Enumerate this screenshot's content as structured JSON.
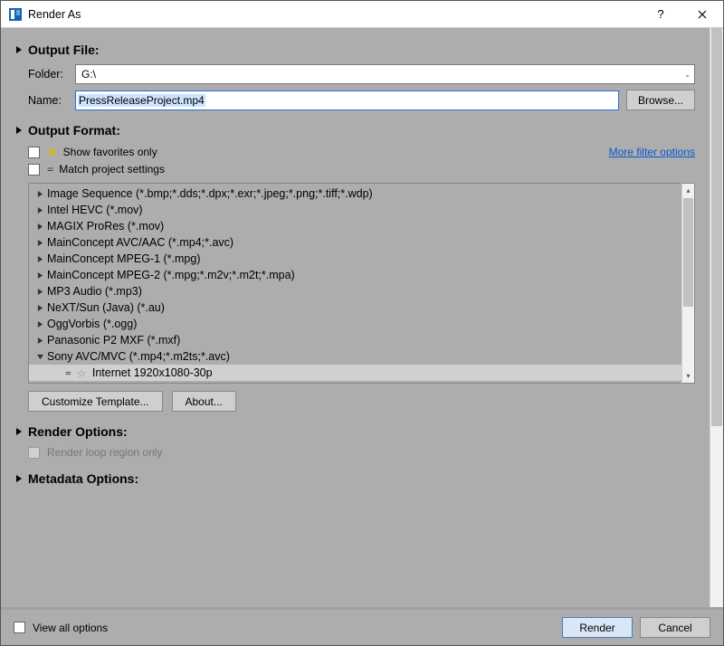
{
  "window": {
    "title": "Render As"
  },
  "sections": {
    "output_file": "Output File:",
    "output_format": "Output Format:",
    "render_options": "Render Options:",
    "metadata_options": "Metadata Options:"
  },
  "output_file": {
    "folder_label": "Folder:",
    "folder_value": "G:\\",
    "name_label": "Name:",
    "name_value": "PressReleaseProject.mp4",
    "browse": "Browse..."
  },
  "output_format": {
    "show_favorites": "Show favorites only",
    "match_project": "Match project settings",
    "more_filter": "More filter options",
    "customize": "Customize Template...",
    "about": "About...",
    "tree": [
      {
        "label": "Image Sequence (*.bmp;*.dds;*.dpx;*.exr;*.jpeg;*.png;*.tiff;*.wdp)",
        "expanded": false
      },
      {
        "label": "Intel HEVC (*.mov)",
        "expanded": false
      },
      {
        "label": "MAGIX ProRes (*.mov)",
        "expanded": false
      },
      {
        "label": "MainConcept AVC/AAC (*.mp4;*.avc)",
        "expanded": false
      },
      {
        "label": "MainConcept MPEG-1 (*.mpg)",
        "expanded": false
      },
      {
        "label": "MainConcept MPEG-2 (*.mpg;*.m2v;*.m2t;*.mpa)",
        "expanded": false
      },
      {
        "label": "MP3 Audio (*.mp3)",
        "expanded": false
      },
      {
        "label": "NeXT/Sun (Java) (*.au)",
        "expanded": false
      },
      {
        "label": "OggVorbis (*.ogg)",
        "expanded": false
      },
      {
        "label": "Panasonic P2 MXF (*.mxf)",
        "expanded": false
      },
      {
        "label": "Sony AVC/MVC (*.mp4;*.m2ts;*.avc)",
        "expanded": true
      }
    ],
    "selected_preset": "Internet 1920x1080-30p"
  },
  "render_options": {
    "loop_region": "Render loop region only"
  },
  "footer": {
    "view_all": "View all options",
    "render": "Render",
    "cancel": "Cancel"
  }
}
